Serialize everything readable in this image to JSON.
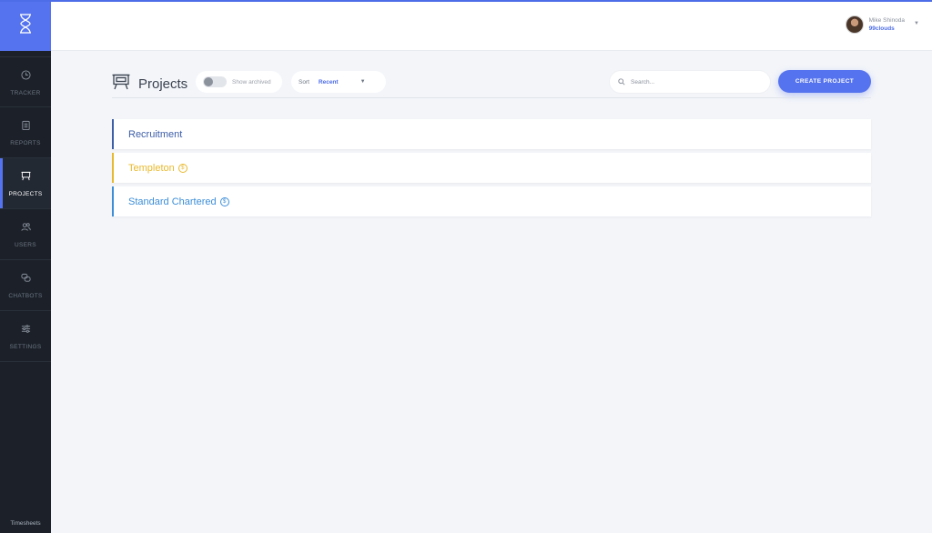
{
  "colors": {
    "accent": "#5573ee",
    "sidebar_bg": "#1c2129",
    "page_bg": "#f3f5f9"
  },
  "sidebar": {
    "logo_icon": "hourglass-icon",
    "items": [
      {
        "label": "TRACKER",
        "icon": "clock-icon",
        "active": false
      },
      {
        "label": "REPORTS",
        "icon": "clipboard-icon",
        "active": false
      },
      {
        "label": "PROJECTS",
        "icon": "presentation-board-icon",
        "active": true
      },
      {
        "label": "USERS",
        "icon": "users-icon",
        "active": false
      },
      {
        "label": "CHATBOTS",
        "icon": "chat-bubbles-icon",
        "active": false
      },
      {
        "label": "SETTINGS",
        "icon": "sliders-icon",
        "active": false
      }
    ],
    "footer": "Timesheets"
  },
  "header": {
    "user_name": "Mike Shinoda",
    "organization": "99clouds"
  },
  "toolbar": {
    "title": "Projects",
    "show_archived_label": "Show archived",
    "sort_label": "Sort",
    "sort_value": "Recent",
    "search_placeholder": "Search...",
    "create_button": "CREATE PROJECT"
  },
  "projects": [
    {
      "name": "Recruitment",
      "color": "#3d5ea8",
      "billable": false
    },
    {
      "name": "Templeton",
      "color": "#e8b92e",
      "billable": true
    },
    {
      "name": "Standard Chartered",
      "color": "#3d8ed8",
      "billable": true
    }
  ],
  "billable_symbol": "$"
}
